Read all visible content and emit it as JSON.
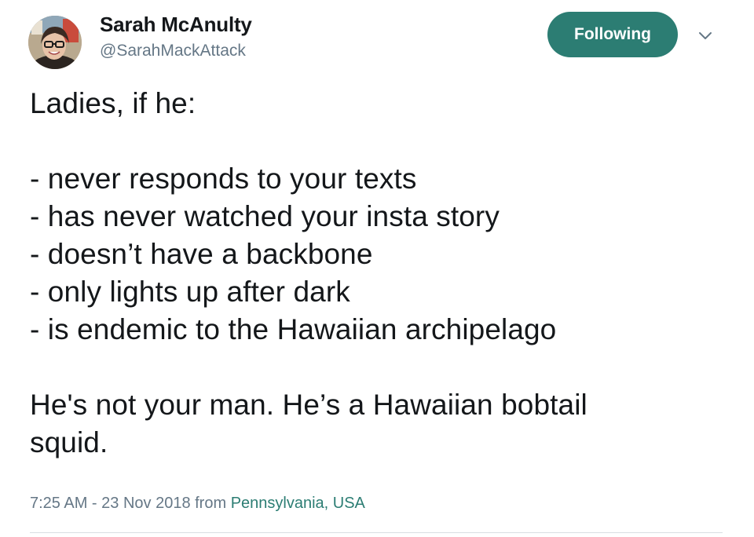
{
  "tweet": {
    "author": {
      "display_name": "Sarah McAnulty",
      "handle": "@SarahMackAttack",
      "avatar_icon": "profile-photo"
    },
    "follow_button_label": "Following",
    "menu_icon": "chevron-down-icon",
    "accent_color": "#2c7d73",
    "text": {
      "intro": "Ladies, if he:",
      "items": [
        "- never responds to your texts",
        "- has never watched your insta story",
        "- doesn’t have a backbone",
        "- only lights up after dark",
        "- is endemic to the Hawaiian archipelago"
      ],
      "conclusion_line1": "He's not your man. He’s a Hawaiian bobtail",
      "conclusion_line2": "squid."
    },
    "timestamp": "7:25 AM - 23 Nov 2018 from ",
    "location": "Pennsylvania, USA"
  }
}
